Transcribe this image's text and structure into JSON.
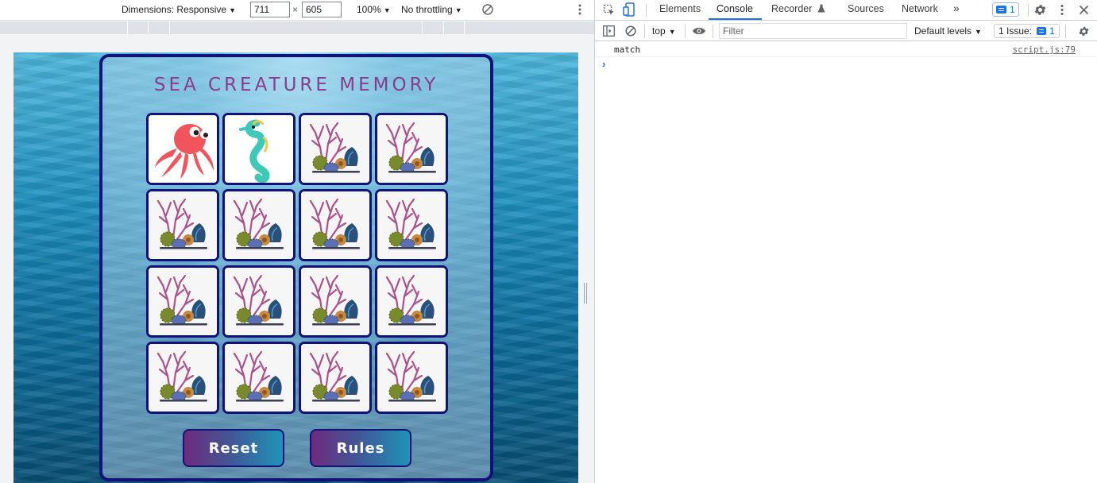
{
  "emulation": {
    "dimensions_label": "Dimensions: Responsive",
    "width_value": "711",
    "times_symbol": "×",
    "height_value": "605",
    "zoom_label": "100%",
    "throttling_label": "No throttling"
  },
  "game": {
    "title": "SEA CREATURE MEMORY",
    "cards": [
      {
        "face": "octopus"
      },
      {
        "face": "seahorse"
      },
      {
        "face": "coral-back"
      },
      {
        "face": "coral-back"
      },
      {
        "face": "coral-back"
      },
      {
        "face": "coral-back"
      },
      {
        "face": "coral-back"
      },
      {
        "face": "coral-back"
      },
      {
        "face": "coral-back"
      },
      {
        "face": "coral-back"
      },
      {
        "face": "coral-back"
      },
      {
        "face": "coral-back"
      },
      {
        "face": "coral-back"
      },
      {
        "face": "coral-back"
      },
      {
        "face": "coral-back"
      },
      {
        "face": "coral-back"
      }
    ],
    "reset_label": "Reset",
    "rules_label": "Rules",
    "colors": {
      "border": "#12137a",
      "title": "#8c3a8c",
      "octopus": "#f2545b",
      "seahorse": "#3ec8b8"
    }
  },
  "devtools": {
    "tabs": [
      "Elements",
      "Console",
      "Recorder",
      "Sources",
      "Network"
    ],
    "active_tab": "Console",
    "recorder_icon": "flask-icon",
    "overflow_label": "»",
    "messages_count": "1",
    "console_bar": {
      "context_label": "top",
      "filter_placeholder": "Filter",
      "levels_label": "Default levels",
      "issues_label": "1 Issue:",
      "issues_count": "1"
    },
    "logs": [
      {
        "message": "match",
        "source": "script.js:79"
      }
    ],
    "prompt_symbol": "›",
    "accent_color": "#1a73e8"
  }
}
